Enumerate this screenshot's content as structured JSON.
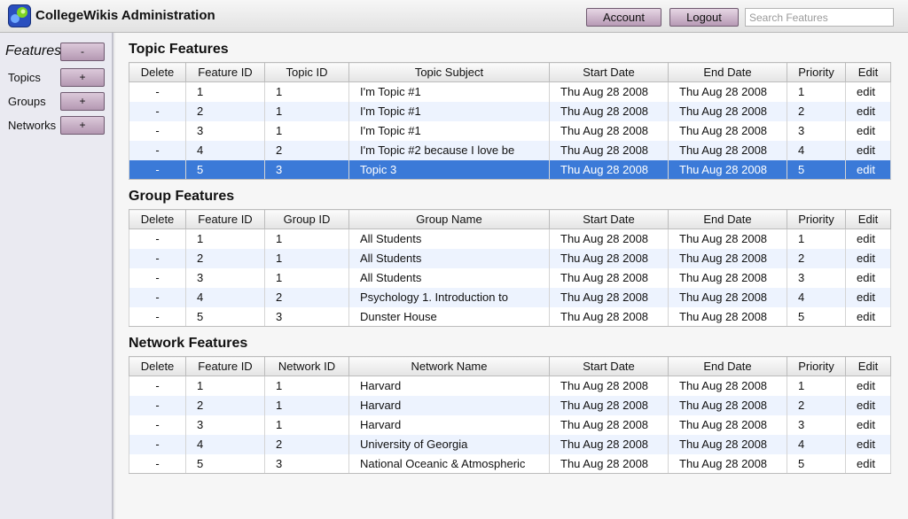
{
  "header": {
    "title": "CollegeWikis Administration",
    "account_label": "Account",
    "logout_label": "Logout",
    "search_placeholder": "Search Features"
  },
  "sidebar": {
    "heading": "Features",
    "heading_button": "-",
    "items": [
      {
        "label": "Topics",
        "button": "+"
      },
      {
        "label": "Groups",
        "button": "+"
      },
      {
        "label": "Networks",
        "button": "+"
      }
    ]
  },
  "colors": {
    "accent_purple": "#b498b2",
    "selected_row": "#3b7ad8",
    "alt_row": "#edf3fe"
  },
  "sections": [
    {
      "title": "Topic Features",
      "columns": [
        "Delete",
        "Feature ID",
        "Topic ID",
        "Topic Subject",
        "Start Date",
        "End Date",
        "Priority",
        "Edit"
      ],
      "selected_row": 4,
      "rows": [
        [
          "-",
          "1",
          "1",
          "I'm Topic #1",
          "Thu Aug 28 2008",
          "Thu Aug 28 2008",
          "1",
          "edit"
        ],
        [
          "-",
          "2",
          "1",
          "I'm Topic #1",
          "Thu Aug 28 2008",
          "Thu Aug 28 2008",
          "2",
          "edit"
        ],
        [
          "-",
          "3",
          "1",
          "I'm Topic #1",
          "Thu Aug 28 2008",
          "Thu Aug 28 2008",
          "3",
          "edit"
        ],
        [
          "-",
          "4",
          "2",
          "I'm Topic #2 because I love be",
          "Thu Aug 28 2008",
          "Thu Aug 28 2008",
          "4",
          "edit"
        ],
        [
          "-",
          "5",
          "3",
          "Topic 3",
          "Thu Aug 28 2008",
          "Thu Aug 28 2008",
          "5",
          "edit"
        ]
      ]
    },
    {
      "title": "Group Features",
      "columns": [
        "Delete",
        "Feature ID",
        "Group ID",
        "Group Name",
        "Start Date",
        "End Date",
        "Priority",
        "Edit"
      ],
      "selected_row": -1,
      "rows": [
        [
          "-",
          "1",
          "1",
          "All Students",
          "Thu Aug 28 2008",
          "Thu Aug 28 2008",
          "1",
          "edit"
        ],
        [
          "-",
          "2",
          "1",
          "All Students",
          "Thu Aug 28 2008",
          "Thu Aug 28 2008",
          "2",
          "edit"
        ],
        [
          "-",
          "3",
          "1",
          "All Students",
          "Thu Aug 28 2008",
          "Thu Aug 28 2008",
          "3",
          "edit"
        ],
        [
          "-",
          "4",
          "2",
          "Psychology 1. Introduction to",
          "Thu Aug 28 2008",
          "Thu Aug 28 2008",
          "4",
          "edit"
        ],
        [
          "-",
          "5",
          "3",
          "Dunster House",
          "Thu Aug 28 2008",
          "Thu Aug 28 2008",
          "5",
          "edit"
        ]
      ]
    },
    {
      "title": "Network Features",
      "columns": [
        "Delete",
        "Feature ID",
        "Network ID",
        "Network Name",
        "Start Date",
        "End Date",
        "Priority",
        "Edit"
      ],
      "selected_row": -1,
      "rows": [
        [
          "-",
          "1",
          "1",
          "Harvard",
          "Thu Aug 28 2008",
          "Thu Aug 28 2008",
          "1",
          "edit"
        ],
        [
          "-",
          "2",
          "1",
          "Harvard",
          "Thu Aug 28 2008",
          "Thu Aug 28 2008",
          "2",
          "edit"
        ],
        [
          "-",
          "3",
          "1",
          "Harvard",
          "Thu Aug 28 2008",
          "Thu Aug 28 2008",
          "3",
          "edit"
        ],
        [
          "-",
          "4",
          "2",
          "University of Georgia",
          "Thu Aug 28 2008",
          "Thu Aug 28 2008",
          "4",
          "edit"
        ],
        [
          "-",
          "5",
          "3",
          "National Oceanic & Atmospheric",
          "Thu Aug 28 2008",
          "Thu Aug 28 2008",
          "5",
          "edit"
        ]
      ]
    }
  ]
}
